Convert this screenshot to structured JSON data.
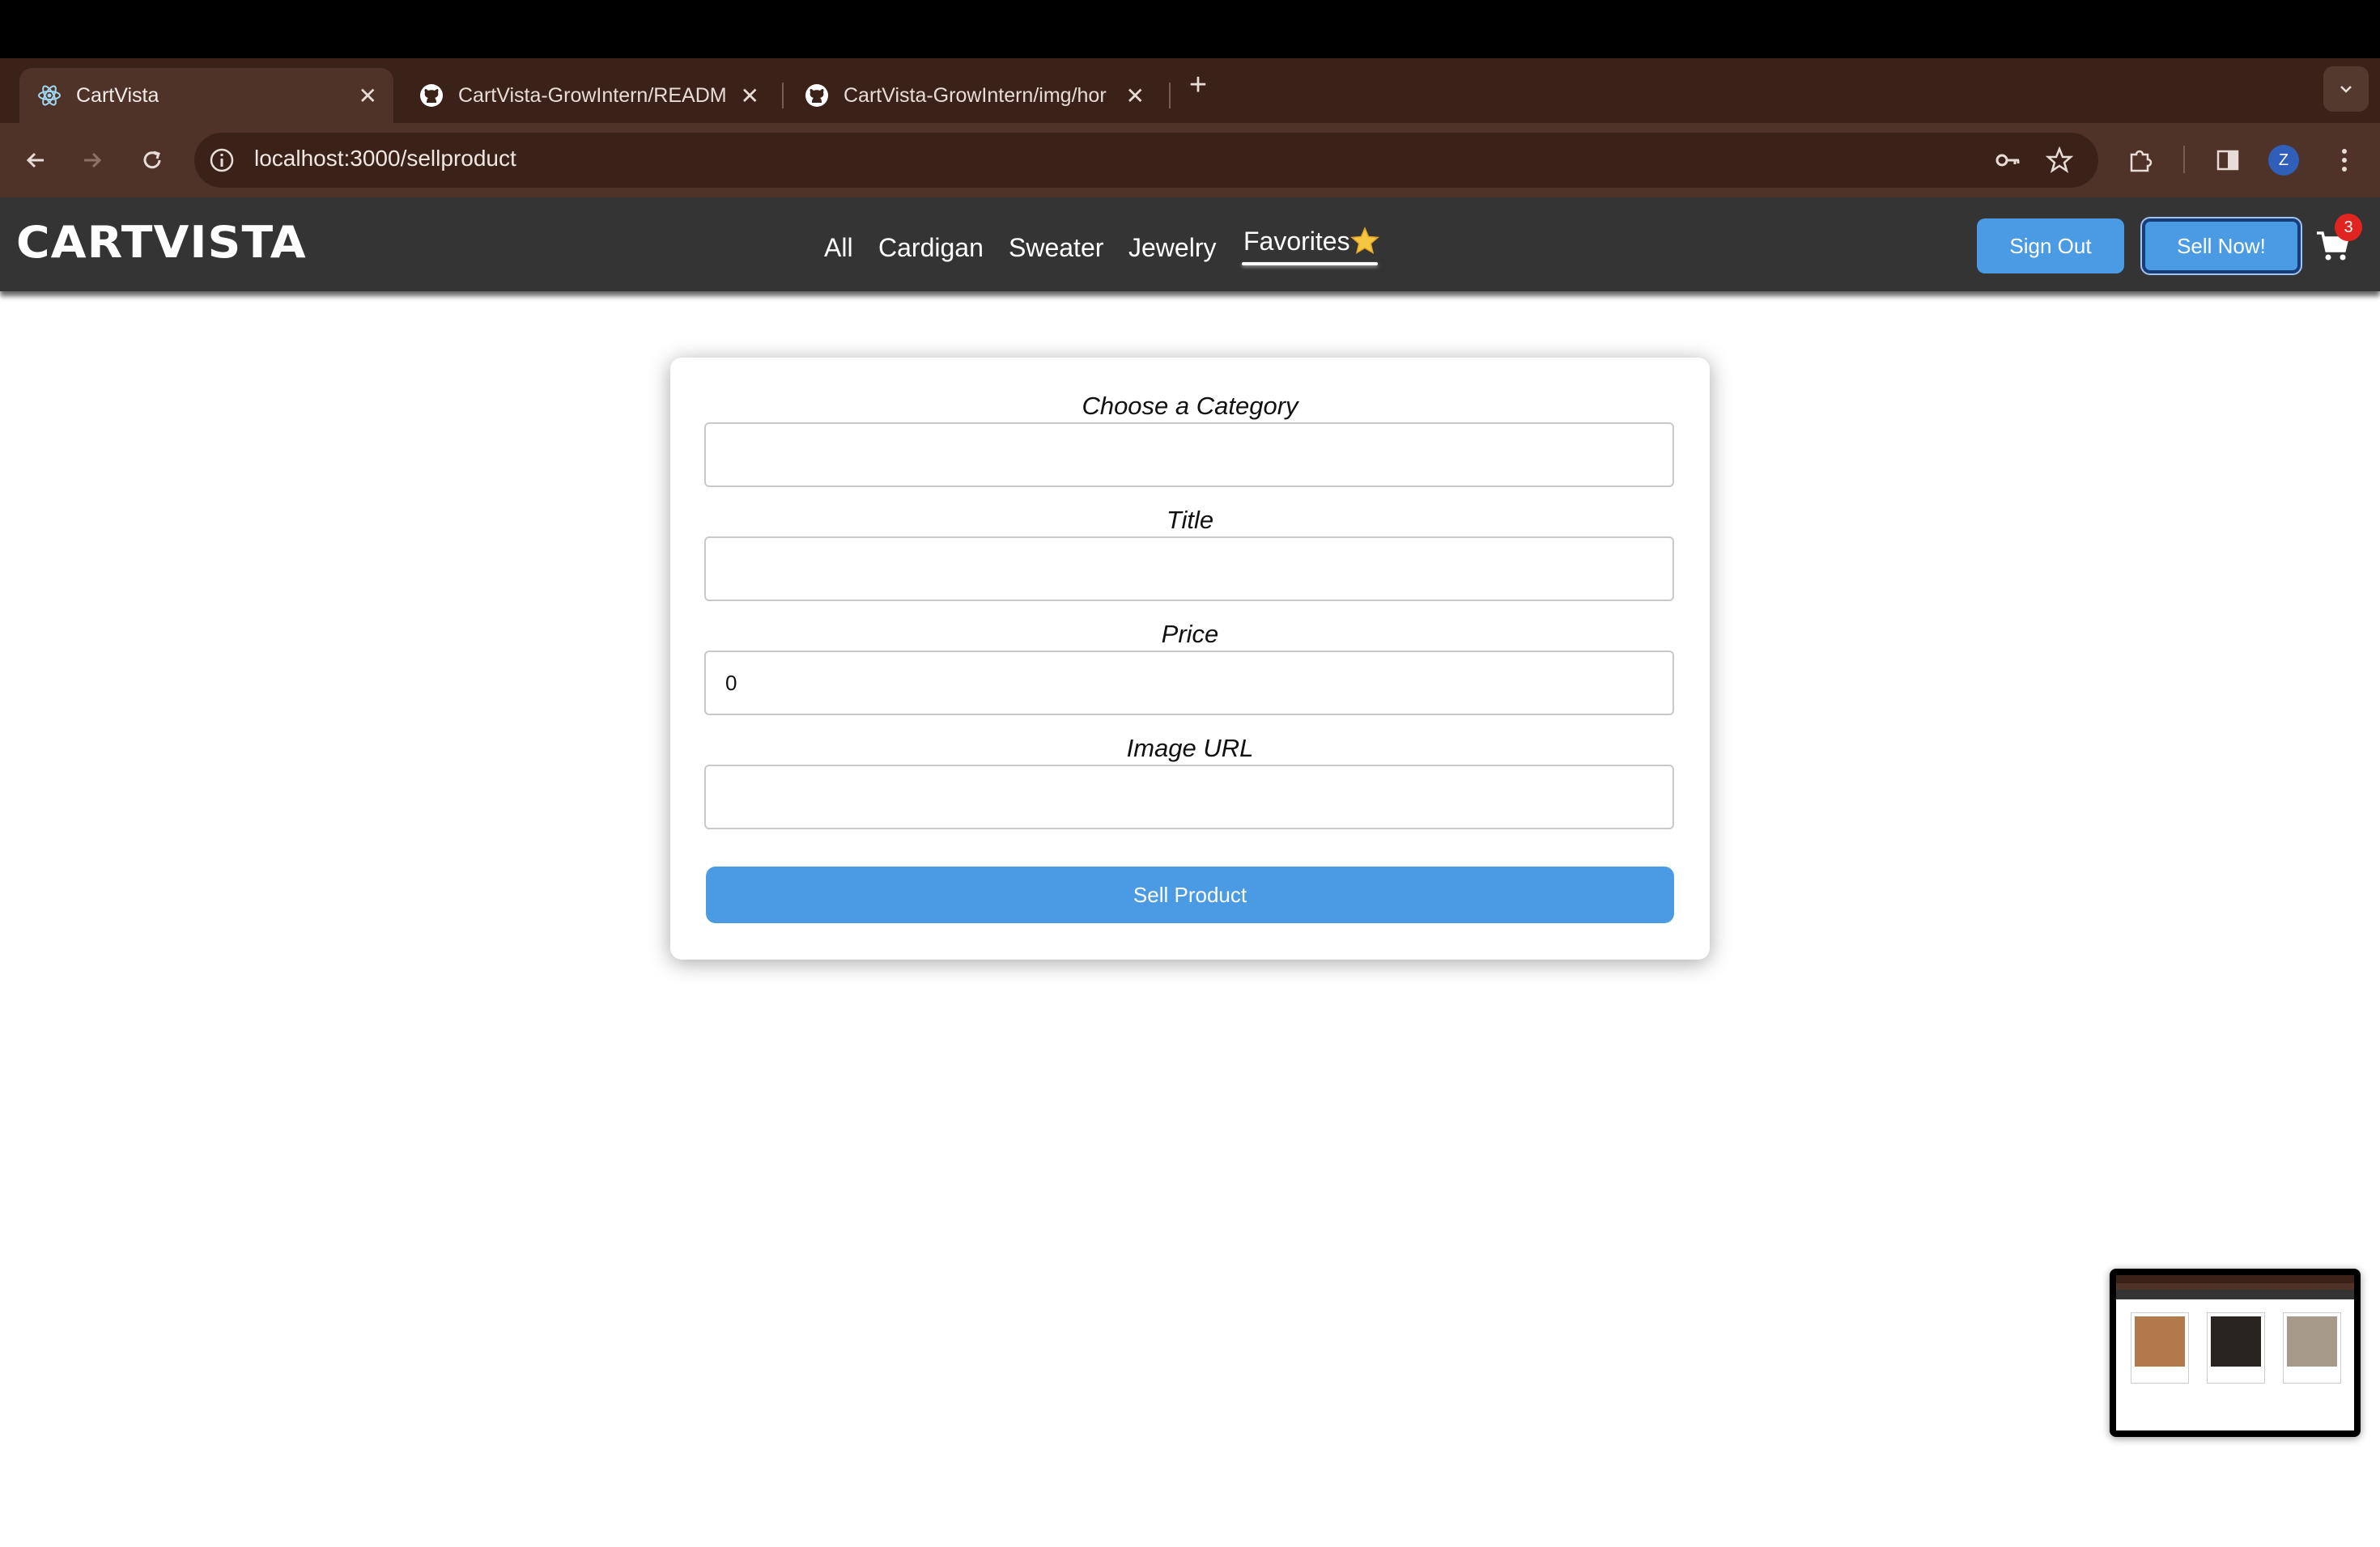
{
  "browser": {
    "tabs": [
      {
        "title": "CartVista",
        "icon": "react-icon",
        "active": true
      },
      {
        "title": "CartVista-GrowIntern/READM",
        "icon": "github-icon",
        "active": false
      },
      {
        "title": "CartVista-GrowIntern/img/hor",
        "icon": "github-icon",
        "active": false
      }
    ],
    "url": "localhost:3000/sellproduct",
    "profile_initial": "Z"
  },
  "navbar": {
    "logo": "CARTVISTA",
    "links": [
      "All",
      "Cardigan",
      "Sweater",
      "Jewelry",
      "Favorites"
    ],
    "favorites_icon": "star-icon",
    "sign_out": "Sign Out",
    "sell_now": "Sell Now!",
    "cart_count": "3"
  },
  "form": {
    "category_label": "Choose a Category",
    "category_value": "",
    "title_label": "Title",
    "title_value": "",
    "price_label": "Price",
    "price_value": "0",
    "image_label": "Image URL",
    "image_value": "",
    "submit_label": "Sell Product"
  },
  "colors": {
    "accent": "#4a9be4",
    "navbar_bg": "#343434",
    "browser_frame": "#4f3328",
    "badge": "#e0241f"
  }
}
